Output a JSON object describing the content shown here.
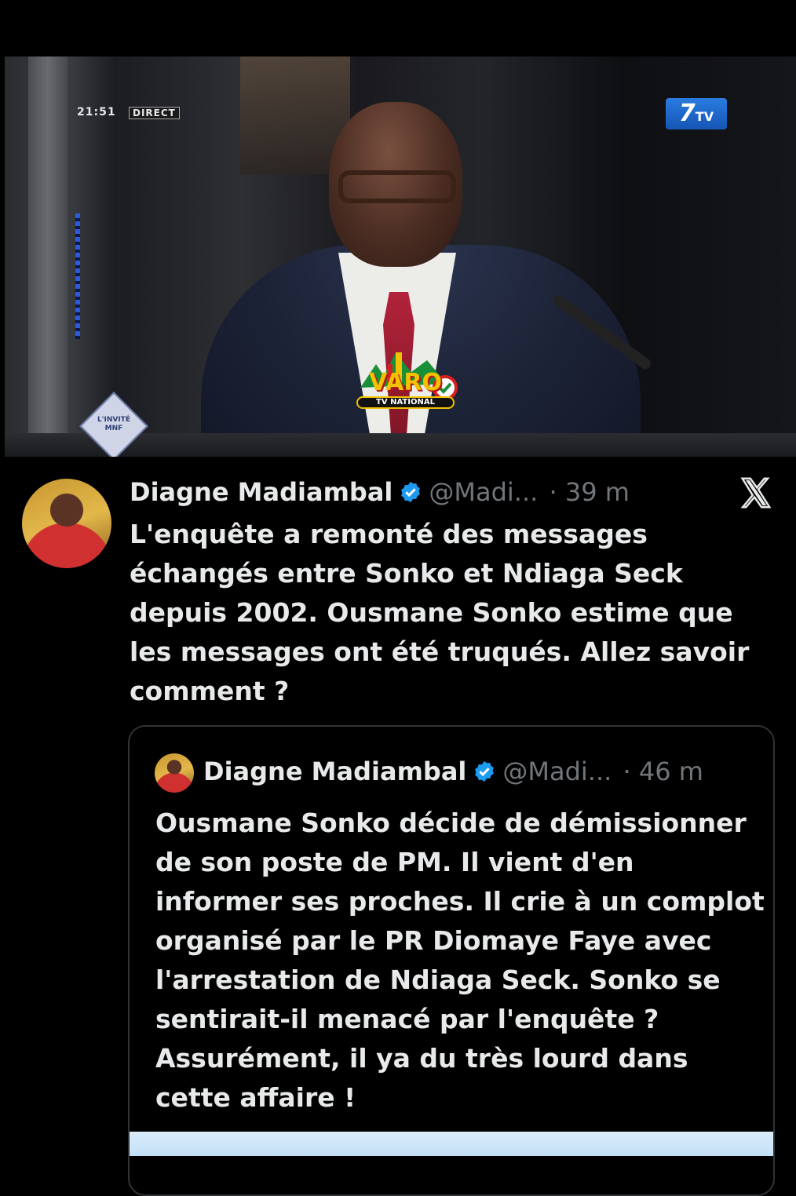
{
  "video": {
    "timestamp": "21:51",
    "live_badge": "DIRECT",
    "channel_logo": "7",
    "channel_logo_suffix": "TV",
    "guest_badge": "L'INVITÉ MNF",
    "watermark": {
      "title": "VARO",
      "subtitle": "TV NATIONAL"
    }
  },
  "tweet": {
    "author_name": "Diagne Madiambal",
    "handle": "@Madi...",
    "separator": "·",
    "time": "39 m",
    "text": "L'enquête a remonté des messages échangés entre Sonko et Ndiaga Seck depuis 2002.  Ousmane Sonko estime que les messages ont été truqués.  Allez savoir comment ?",
    "platform_icon": "x-logo-icon"
  },
  "quoted_tweet": {
    "author_name": "Diagne Madiambal",
    "handle": "@Madi...",
    "separator": "·",
    "time": "46 m",
    "text": "Ousmane Sonko décide de démissionner de son poste de PM. Il vient d'en informer ses proches. Il crie à un complot organisé par le PR Diomaye Faye avec l'arrestation de Ndiaga Seck. Sonko se sentirait-il menacé par l'enquête ? Assurément, il ya du très lourd dans cette affaire !"
  },
  "colors": {
    "background": "#000000",
    "text": "#e7e9ea",
    "muted": "#71767b",
    "verified": "#1d9bf0",
    "card_border": "#2f3336"
  }
}
